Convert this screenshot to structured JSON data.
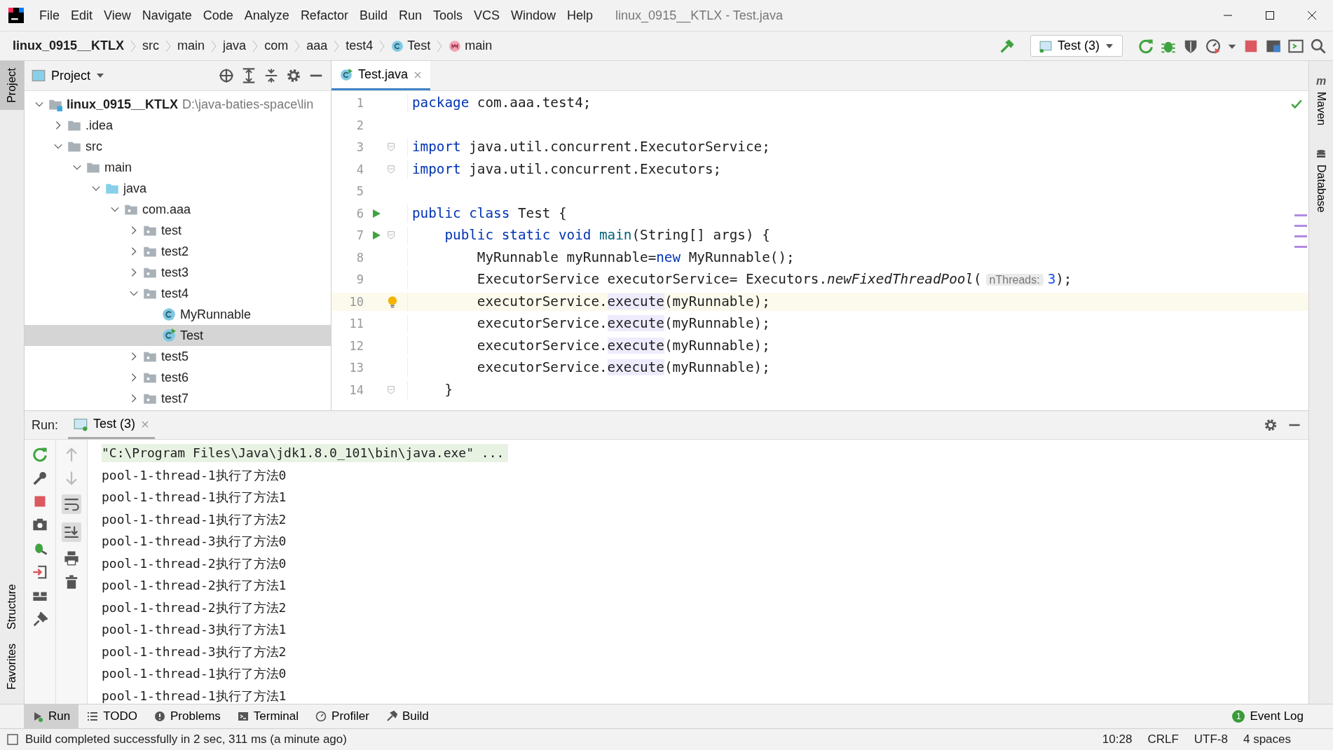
{
  "window": {
    "title": "linux_0915__KTLX - Test.java"
  },
  "menu": [
    "File",
    "Edit",
    "View",
    "Navigate",
    "Code",
    "Analyze",
    "Refactor",
    "Build",
    "Run",
    "Tools",
    "VCS",
    "Window",
    "Help"
  ],
  "breadcrumbs": [
    {
      "label": "linux_0915__KTLX",
      "kind": "project"
    },
    {
      "label": "src",
      "kind": "plain"
    },
    {
      "label": "main",
      "kind": "plain"
    },
    {
      "label": "java",
      "kind": "plain"
    },
    {
      "label": "com",
      "kind": "plain"
    },
    {
      "label": "aaa",
      "kind": "plain"
    },
    {
      "label": "test4",
      "kind": "plain"
    },
    {
      "label": "Test",
      "kind": "class"
    },
    {
      "label": "main",
      "kind": "method"
    }
  ],
  "run_config": {
    "label": "Test (3)"
  },
  "left_stripe": [
    {
      "label": "Project",
      "selected": true
    },
    {
      "label": "Structure",
      "selected": false
    },
    {
      "label": "Favorites",
      "selected": false
    }
  ],
  "right_stripe": [
    {
      "label": "Maven",
      "glyph": "m"
    },
    {
      "label": "Database"
    }
  ],
  "project": {
    "title": "Project",
    "tree": [
      {
        "label": "linux_0915__KTLX",
        "path": "D:\\java-baties-space\\lin",
        "kind": "module",
        "expanded": true,
        "selected": false,
        "children": [
          {
            "label": ".idea",
            "kind": "folder",
            "expanded": false,
            "selected": false
          },
          {
            "label": "src",
            "kind": "folder",
            "expanded": true,
            "selected": false,
            "children": [
              {
                "label": "main",
                "kind": "folder",
                "expanded": true,
                "selected": false,
                "children": [
                  {
                    "label": "java",
                    "kind": "source",
                    "expanded": true,
                    "selected": false,
                    "children": [
                      {
                        "label": "com.aaa",
                        "kind": "package",
                        "expanded": true,
                        "selected": false,
                        "children": [
                          {
                            "label": "test",
                            "kind": "package",
                            "expanded": false,
                            "selected": false
                          },
                          {
                            "label": "test2",
                            "kind": "package",
                            "expanded": false,
                            "selected": false
                          },
                          {
                            "label": "test3",
                            "kind": "package",
                            "expanded": false,
                            "selected": false
                          },
                          {
                            "label": "test4",
                            "kind": "package",
                            "expanded": true,
                            "selected": false,
                            "children": [
                              {
                                "label": "MyRunnable",
                                "kind": "class",
                                "selected": false
                              },
                              {
                                "label": "Test",
                                "kind": "main-class",
                                "selected": true
                              }
                            ]
                          },
                          {
                            "label": "test5",
                            "kind": "package",
                            "expanded": false,
                            "selected": false
                          },
                          {
                            "label": "test6",
                            "kind": "package",
                            "expanded": false,
                            "selected": false
                          },
                          {
                            "label": "test7",
                            "kind": "package",
                            "expanded": false,
                            "selected": false
                          }
                        ]
                      }
                    ]
                  }
                ]
              }
            ]
          }
        ]
      }
    ]
  },
  "editor": {
    "tabs": [
      {
        "label": "Test.java",
        "selected": true
      }
    ],
    "lines": [
      {
        "number": "1",
        "current": false,
        "run_marker": false,
        "fold_marker": false,
        "bulb": false,
        "tokens": [
          {
            "kind": "kw",
            "text": "package"
          },
          {
            "kind": "plain",
            "text": " com.aaa.test4;"
          }
        ]
      },
      {
        "number": "2",
        "current": false,
        "run_marker": false,
        "fold_marker": false,
        "bulb": false
      },
      {
        "number": "3",
        "current": false,
        "run_marker": false,
        "fold_marker": true,
        "bulb": false,
        "tokens": [
          {
            "kind": "kw",
            "text": "import"
          },
          {
            "kind": "plain",
            "text": " java.util.concurrent.ExecutorService;"
          }
        ]
      },
      {
        "number": "4",
        "current": false,
        "run_marker": false,
        "fold_marker": true,
        "bulb": false,
        "tokens": [
          {
            "kind": "kw",
            "text": "import"
          },
          {
            "kind": "plain",
            "text": " java.util.concurrent.Executors;"
          }
        ]
      },
      {
        "number": "5",
        "current": false,
        "run_marker": false,
        "fold_marker": false,
        "bulb": false
      },
      {
        "number": "6",
        "current": false,
        "run_marker": true,
        "fold_marker": false,
        "bulb": false,
        "tokens": [
          {
            "kind": "kw",
            "text": "public class"
          },
          {
            "kind": "plain",
            "text": " Test {"
          }
        ]
      },
      {
        "number": "7",
        "current": false,
        "run_marker": true,
        "fold_marker": true,
        "bulb": false,
        "tokens": [
          {
            "kind": "kw",
            "text": "    public static void "
          },
          {
            "kind": "method",
            "text": "main"
          },
          {
            "kind": "plain",
            "text": "(String[] args) {"
          }
        ]
      },
      {
        "number": "8",
        "current": false,
        "run_marker": false,
        "fold_marker": false,
        "bulb": false,
        "tokens": [
          {
            "kind": "plain",
            "text": "        MyRunnable myRunnable="
          },
          {
            "kind": "kw",
            "text": "new"
          },
          {
            "kind": "plain",
            "text": " MyRunnable();"
          }
        ]
      },
      {
        "number": "9",
        "current": false,
        "run_marker": false,
        "fold_marker": false,
        "bulb": false,
        "tokens": [
          {
            "kind": "plain",
            "text": "        ExecutorService executorService= Executors."
          },
          {
            "kind": "static",
            "text": "newFixedThreadPool"
          },
          {
            "kind": "plain",
            "text": "("
          },
          {
            "kind": "hint",
            "text": "nThreads:"
          },
          {
            "kind": "number",
            "text": "3"
          },
          {
            "kind": "plain",
            "text": ");"
          }
        ]
      },
      {
        "number": "10",
        "current": true,
        "run_marker": false,
        "fold_marker": false,
        "bulb": true,
        "tokens": [
          {
            "kind": "plain",
            "text": "        executorService."
          },
          {
            "kind": "highlight",
            "text": "execute"
          },
          {
            "kind": "plain",
            "text": "(myRunnable);"
          }
        ]
      },
      {
        "number": "11",
        "current": false,
        "run_marker": false,
        "fold_marker": false,
        "bulb": false,
        "tokens": [
          {
            "kind": "plain",
            "text": "        executorService."
          },
          {
            "kind": "highlight",
            "text": "execute"
          },
          {
            "kind": "plain",
            "text": "(myRunnable);"
          }
        ]
      },
      {
        "number": "12",
        "current": false,
        "run_marker": false,
        "fold_marker": false,
        "bulb": false,
        "tokens": [
          {
            "kind": "plain",
            "text": "        executorService."
          },
          {
            "kind": "highlight",
            "text": "execute"
          },
          {
            "kind": "plain",
            "text": "(myRunnable);"
          }
        ]
      },
      {
        "number": "13",
        "current": false,
        "run_marker": false,
        "fold_marker": false,
        "bulb": false,
        "tokens": [
          {
            "kind": "plain",
            "text": "        executorService."
          },
          {
            "kind": "highlight",
            "text": "execute"
          },
          {
            "kind": "plain",
            "text": "(myRunnable);"
          }
        ]
      },
      {
        "number": "14",
        "current": false,
        "run_marker": false,
        "fold_marker": true,
        "bulb": false,
        "tokens": [
          {
            "kind": "plain",
            "text": "    }"
          }
        ]
      }
    ]
  },
  "run": {
    "title": "Run:",
    "tabs": [
      {
        "label": "Test (3)",
        "selected": true
      }
    ],
    "console": [
      {
        "kind": "command",
        "text": "\"C:\\Program Files\\Java\\jdk1.8.0_101\\bin\\java.exe\" ..."
      },
      {
        "kind": "output",
        "text": "pool-1-thread-1执行了方法0"
      },
      {
        "kind": "output",
        "text": "pool-1-thread-1执行了方法1"
      },
      {
        "kind": "output",
        "text": "pool-1-thread-1执行了方法2"
      },
      {
        "kind": "output",
        "text": "pool-1-thread-3执行了方法0"
      },
      {
        "kind": "output",
        "text": "pool-1-thread-2执行了方法0"
      },
      {
        "kind": "output",
        "text": "pool-1-thread-2执行了方法1"
      },
      {
        "kind": "output",
        "text": "pool-1-thread-2执行了方法2"
      },
      {
        "kind": "output",
        "text": "pool-1-thread-3执行了方法1"
      },
      {
        "kind": "output",
        "text": "pool-1-thread-3执行了方法2"
      },
      {
        "kind": "output",
        "text": "pool-1-thread-1执行了方法0"
      },
      {
        "kind": "output",
        "text": "pool-1-thread-1执行了方法1"
      }
    ]
  },
  "bottom_tools": [
    {
      "label": "Run",
      "kind": "run",
      "selected": true
    },
    {
      "label": "TODO",
      "kind": "todo",
      "selected": false
    },
    {
      "label": "Problems",
      "kind": "problems",
      "selected": false
    },
    {
      "label": "Terminal",
      "kind": "terminal",
      "selected": false
    },
    {
      "label": "Profiler",
      "kind": "profiler",
      "selected": false
    },
    {
      "label": "Build",
      "kind": "build",
      "selected": false
    }
  ],
  "event_log": {
    "label": "Event Log",
    "count": "1"
  },
  "status_bar": {
    "message": "Build completed successfully in 2 sec, 311 ms (a minute ago)",
    "items": [
      "10:28",
      "CRLF",
      "UTF-8",
      "4 spaces"
    ]
  }
}
